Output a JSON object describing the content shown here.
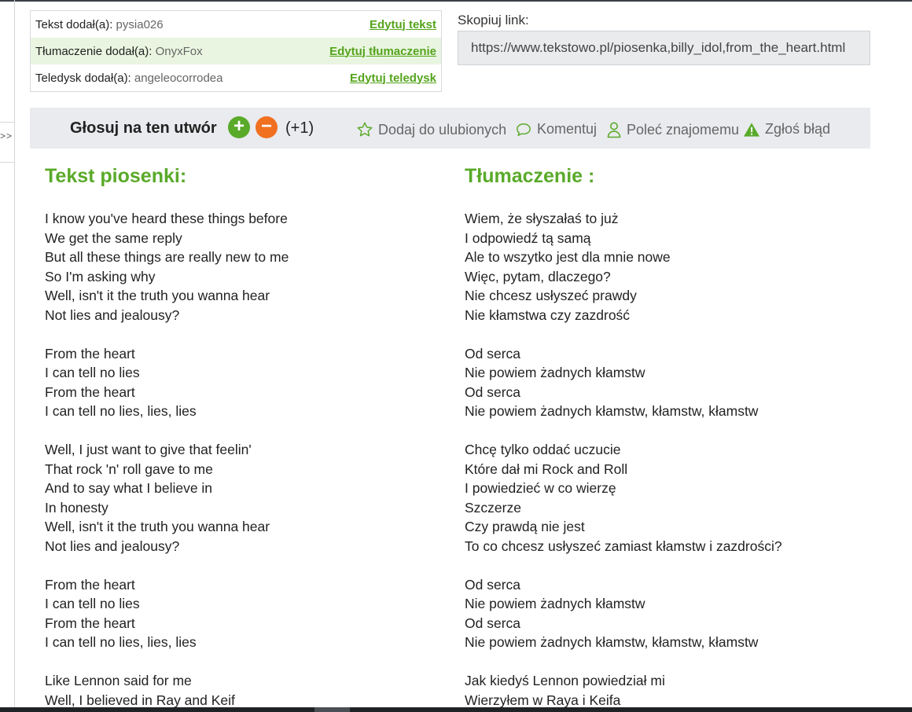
{
  "credits": {
    "text": {
      "label": "Tekst dodał(a): ",
      "user": "pysia026",
      "link": "Edytuj tekst"
    },
    "translation": {
      "label": "Tłumaczenie dodał(a): ",
      "user": "OnyxFox",
      "link": "Edytuj tłumaczenie"
    },
    "video": {
      "label": "Teledysk dodał(a): ",
      "user": "angeleocorrodea",
      "link": "Edytuj teledysk"
    }
  },
  "copy_link": {
    "label": "Skopiuj link:",
    "url": "https://www.tekstowo.pl/piosenka,billy_idol,from_the_heart.html"
  },
  "vote": {
    "label": "Głosuj na ten utwór",
    "plus": "+",
    "minus": "−",
    "count": "(+1)"
  },
  "actions": {
    "favorite": "Dodaj do ulubionych",
    "comment": "Komentuj",
    "recommend": "Poleć znajomemu",
    "report": "Zgłoś błąd"
  },
  "side_toggle": ">>",
  "lyrics": {
    "title": "Tekst piosenki:",
    "lines": [
      "I know you've heard these things before",
      "We get the same reply",
      "But all these things are really new to me",
      "So I'm asking why",
      "Well, isn't it the truth you wanna hear",
      "Not lies and jealousy?",
      "",
      "From the heart",
      "I can tell no lies",
      "From the heart",
      "I can tell no lies, lies, lies",
      "",
      "Well, I just want to give that feelin'",
      "That rock 'n' roll gave to me",
      "And to say what I believe in",
      "In honesty",
      "Well, isn't it the truth you wanna hear",
      "Not lies and jealousy?",
      "",
      "From the heart",
      "I can tell no lies",
      "From the heart",
      "I can tell no lies, lies, lies",
      "",
      "Like Lennon said for me",
      "Well, I believed in Ray and Keif"
    ]
  },
  "translation": {
    "title": "Tłumaczenie :",
    "lines": [
      "Wiem, że słyszałaś to już",
      "I odpowiedź tą samą",
      "Ale to wszytko jest dla mnie nowe",
      "Więc, pytam, dlaczego?",
      "Nie chcesz usłyszeć prawdy",
      "Nie kłamstwa czy zazdrość",
      "",
      "Od serca",
      "Nie powiem żadnych kłamstw",
      "Od serca",
      "Nie powiem żadnych kłamstw, kłamstw, kłamstw",
      "",
      "Chcę tylko oddać uczucie",
      "Które dał mi Rock and Roll",
      "I powiedzieć w co wierzę",
      "Szczerze",
      "Czy prawdą nie jest",
      "To co chcesz usłyszeć zamiast kłamstw i zazdrości?",
      "",
      "Od serca",
      "Nie powiem żadnych kłamstw",
      "Od serca",
      "Nie powiem żadnych kłamstw, kłamstw, kłamstw",
      "",
      "Jak kiedyś Lennon powiedział mi",
      "Wierzyłem w Raya i Keifa"
    ]
  },
  "colors": {
    "accent_green": "#5aaa2a",
    "vote_minus": "#f07020",
    "report_icon": "#5aaa2a"
  }
}
